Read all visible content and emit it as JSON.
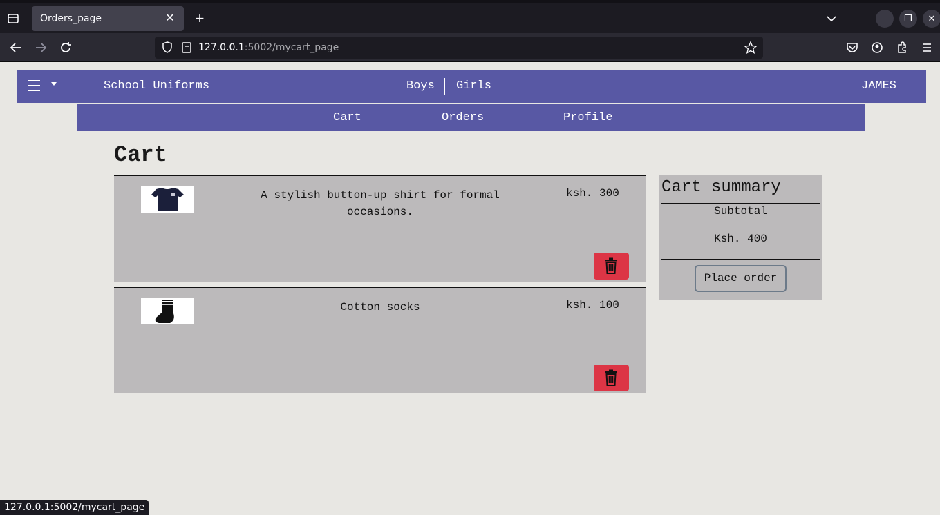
{
  "browser": {
    "tab_title": "Orders_page",
    "url_host": "127.0.0.1",
    "url_path": ":5002/mycart_page",
    "status_url": "127.0.0.1:5002/mycart_page"
  },
  "header": {
    "brand": "School Uniforms",
    "nav_boys": "Boys",
    "nav_girls": "Girls",
    "user": "JAMES"
  },
  "subnav": {
    "cart": "Cart",
    "orders": "Orders",
    "profile": "Profile"
  },
  "page": {
    "title": "Cart"
  },
  "cart_items": [
    {
      "description": "A stylish button-up shirt for formal occasions.",
      "price": "ksh. 300",
      "image": "shirt-icon"
    },
    {
      "description": "Cotton socks",
      "price": "ksh. 100",
      "image": "sock-icon"
    }
  ],
  "summary": {
    "title": "Cart summary",
    "subtotal_label": "Subtotal",
    "subtotal_value": "Ksh. 400",
    "place_order": "Place order"
  },
  "colors": {
    "header_bg": "#5858a4",
    "delete_btn": "#dc3545",
    "card_bg": "#bcbabb",
    "page_bg": "#e8e7e3"
  }
}
